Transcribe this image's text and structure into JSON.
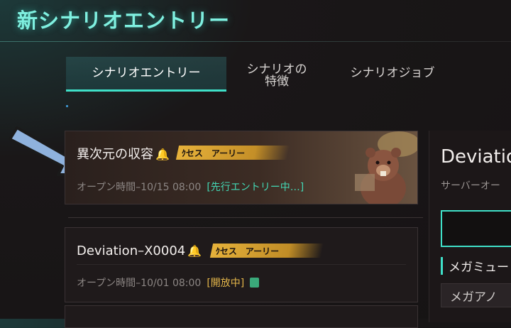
{
  "header": {
    "title": "新シナリオエントリー"
  },
  "tabs": [
    {
      "label": "シナリオエントリー",
      "active": true
    },
    {
      "label_line1": "シナリオの",
      "label_line2": "特徴"
    },
    {
      "label": "シナリオジョブ"
    }
  ],
  "scenarios": [
    {
      "title": "異次元の収容",
      "badge": "ｸセス　アーリー",
      "open_time": "オープン時間–10/15 08:00",
      "status": "[先行エントリー中…]"
    },
    {
      "title": "Deviation–X0004",
      "badge": "ｸセス　アーリー",
      "open_time": "オープン時間–10/01 08:00",
      "status": "[開放中]"
    }
  ],
  "detail": {
    "title": "Deviatio",
    "subtitle": "サーバーオー",
    "section_label": "メガミュー",
    "section_item": "メガアノ"
  },
  "colors": {
    "accent": "#3fe0c8",
    "badge": "#f0b93c",
    "status_open": "#e3b54a",
    "status_pre": "#43d7b4"
  }
}
